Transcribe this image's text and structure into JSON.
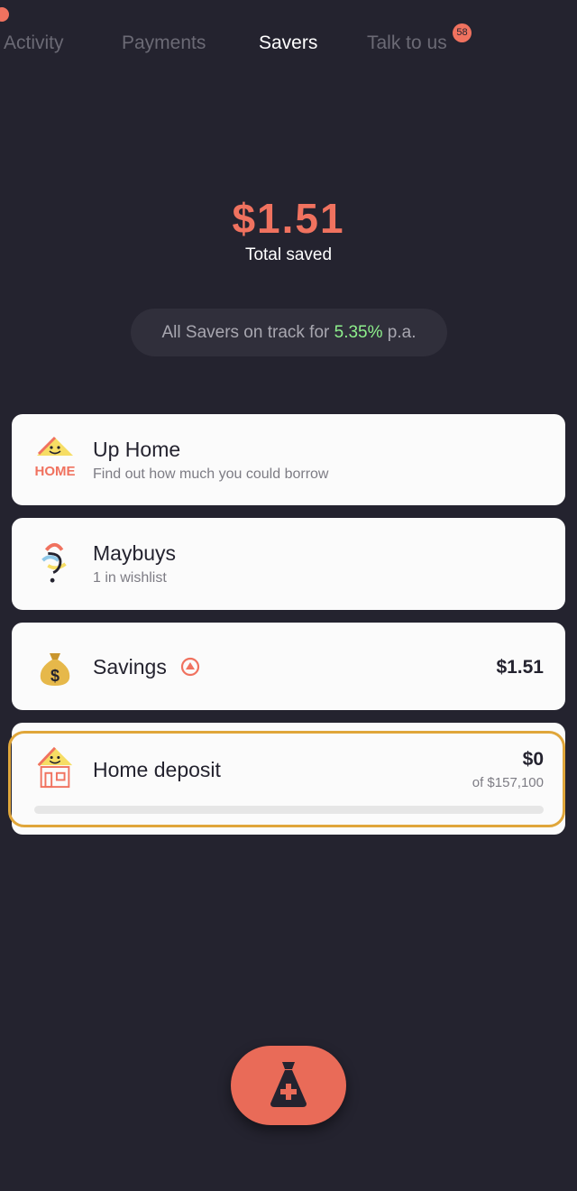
{
  "tabs": [
    {
      "label": "Activity"
    },
    {
      "label": "Payments"
    },
    {
      "label": "Savers"
    },
    {
      "label": "Talk to us",
      "badge": "58"
    }
  ],
  "summary": {
    "total": "$1.51",
    "total_label": "Total saved",
    "track_prefix": "All Savers on track for ",
    "track_rate": "5.35%",
    "track_suffix": " p.a."
  },
  "cards": {
    "up_home": {
      "title": "Up Home",
      "subtitle": "Find out how much you could borrow",
      "icon": "home-smile-icon"
    },
    "maybuys": {
      "title": "Maybuys",
      "subtitle": "1 in wishlist",
      "icon": "question-swirl-icon"
    },
    "savings": {
      "title": "Savings",
      "amount": "$1.51",
      "icon": "money-bag-icon",
      "status_icon": "up-arrow-circle-icon"
    },
    "home_deposit": {
      "title": "Home deposit",
      "amount": "$0",
      "goal": "of $157,100",
      "progress": 0,
      "icon": "house-icon"
    }
  },
  "fab": {
    "icon": "money-bag-plus-icon"
  },
  "colors": {
    "accent": "#f0725f",
    "rate_green": "#8ef08c",
    "highlight": "#e0a63a",
    "background": "#24232f"
  }
}
